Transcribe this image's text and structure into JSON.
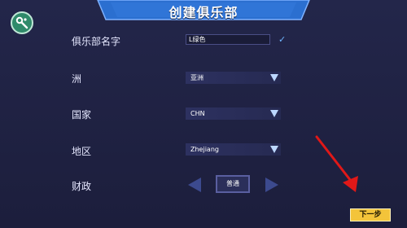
{
  "header": {
    "title": "创建俱乐部"
  },
  "toolbar": {
    "tool_icon": "tools-icon"
  },
  "form": {
    "club_name": {
      "label": "俱乐部名字",
      "value": "L绿色"
    },
    "continent": {
      "label": "洲",
      "value": "亚洲"
    },
    "country": {
      "label": "国家",
      "value": "CHN"
    },
    "region": {
      "label": "地区",
      "value": "Zhejiang"
    },
    "finance": {
      "label": "财政",
      "value": "普通"
    }
  },
  "footer": {
    "next_label": "下一步"
  },
  "colors": {
    "background": "#1f2142",
    "banner": "#2b6fd0",
    "next_button": "#f3c43a",
    "annotation_arrow": "#e01818"
  }
}
